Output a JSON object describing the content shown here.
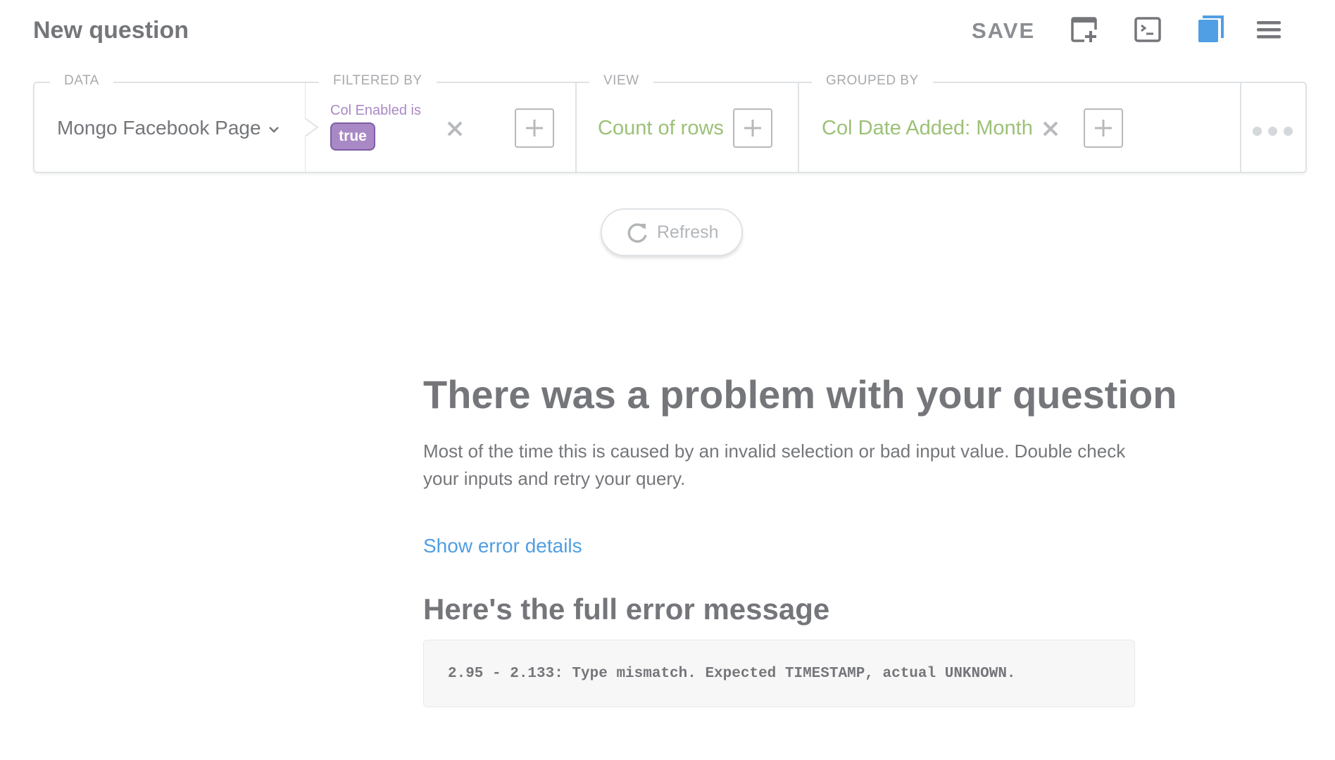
{
  "header": {
    "title": "New question",
    "save_label": "SAVE",
    "icons": [
      "add-to-dashboard-icon",
      "sql-editor-icon",
      "reference-book-icon",
      "menu-icon"
    ],
    "active_icon_color": "#509ee3"
  },
  "query_builder": {
    "data": {
      "label": "DATA",
      "value": "Mongo Facebook Page"
    },
    "filter": {
      "label": "FILTERED BY",
      "field": "Col Enabled is",
      "value": "true"
    },
    "view": {
      "label": "VIEW",
      "value": "Count of rows"
    },
    "group": {
      "label": "GROUPED BY",
      "value": "Col Date Added: Month"
    }
  },
  "refresh": {
    "label": "Refresh"
  },
  "error": {
    "title": "There was a problem with your question",
    "description": "Most of the time this is caused by an invalid selection or bad input value. Double check your inputs and retry your query.",
    "details_link": "Show error details",
    "full_message_heading": "Here's the full error message",
    "message": "2.95 - 2.133: Type mismatch. Expected TIMESTAMP, actual UNKNOWN."
  },
  "colors": {
    "filter": "#a989c5",
    "aggregation": "#9cc177",
    "link": "#509ee3",
    "text": "#74767a"
  }
}
